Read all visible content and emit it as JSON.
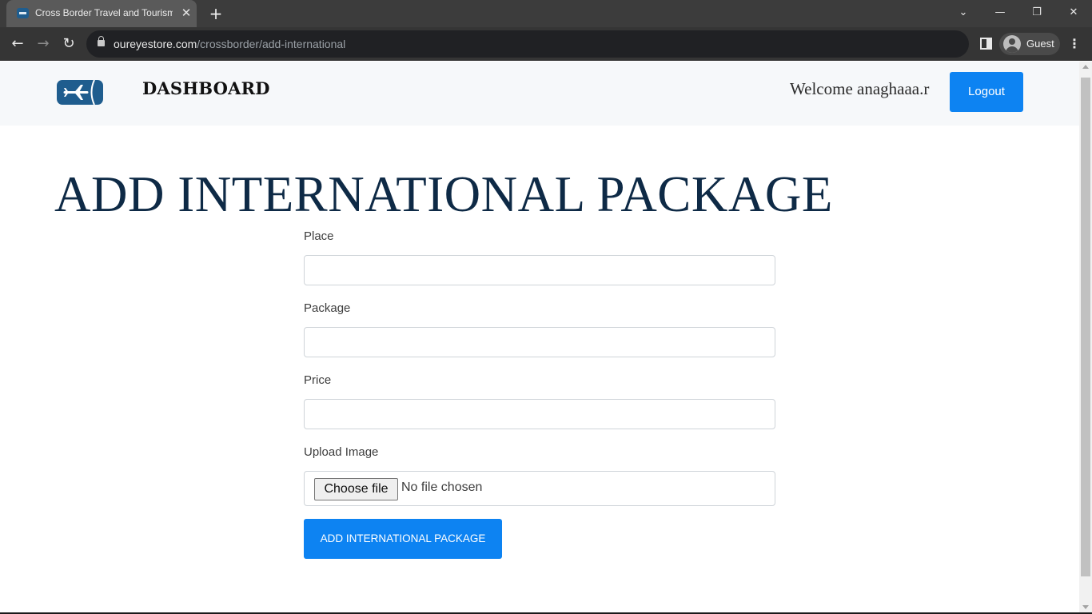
{
  "browser": {
    "tab_title": "Cross Border Travel and Tourism",
    "tab_close": "✕",
    "new_tab": "+",
    "url_domain": "oureyestore.com",
    "url_path": "/crossborder/add-international",
    "profile_label": "Guest",
    "window_controls": {
      "dropdown": "⌄",
      "minimize": "—",
      "restore": "❐",
      "close": "✕"
    },
    "nav": {
      "back": "←",
      "forward": "→",
      "reload": "↻",
      "menu": "⋮"
    }
  },
  "header": {
    "brand": "DASHBOARD",
    "welcome": "Welcome anaghaaa.r",
    "logout_label": "Logout",
    "logo_color": "#1f5d8e"
  },
  "main": {
    "title": "ADD INTERNATIONAL PACKAGE",
    "fields": {
      "place_label": "Place",
      "place_value": "",
      "package_label": "Package",
      "package_value": "",
      "price_label": "Price",
      "price_value": "",
      "upload_label": "Upload Image",
      "choose_file_label": "Choose file",
      "file_status": "No file chosen"
    },
    "submit_label": "ADD INTERNATIONAL PACKAGE"
  },
  "colors": {
    "accent": "#0d83f2",
    "title_color": "#0e2a46",
    "header_bg": "#f6f8fa"
  }
}
